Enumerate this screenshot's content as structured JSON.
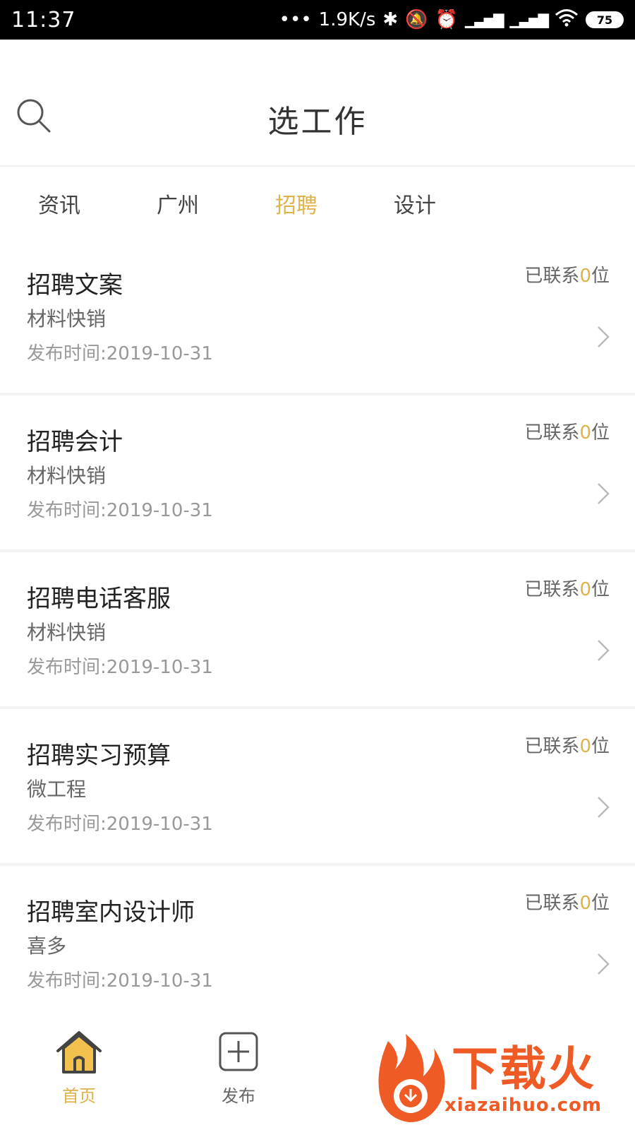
{
  "status_bar": {
    "time": "11:37",
    "net_speed": "1.9K/s",
    "battery": "75",
    "icons": [
      "bluetooth-icon",
      "mute-icon",
      "alarm-icon",
      "hd-signal-icon",
      "signal-icon",
      "wifi-icon",
      "battery-icon"
    ]
  },
  "header": {
    "title": "选工作",
    "search_icon": "search-icon"
  },
  "tabs": [
    {
      "label": "资讯",
      "active": false
    },
    {
      "label": "广州",
      "active": false
    },
    {
      "label": "招聘",
      "active": true
    },
    {
      "label": "设计",
      "active": false
    }
  ],
  "jobs": [
    {
      "title": "招聘文案",
      "company": "材料快销",
      "date": "发布时间:2019-10-31",
      "contact_prefix": "已联系",
      "contact_count": "0",
      "contact_suffix": "位"
    },
    {
      "title": "招聘会计",
      "company": "材料快销",
      "date": "发布时间:2019-10-31",
      "contact_prefix": "已联系",
      "contact_count": "0",
      "contact_suffix": "位"
    },
    {
      "title": "招聘电话客服",
      "company": "材料快销",
      "date": "发布时间:2019-10-31",
      "contact_prefix": "已联系",
      "contact_count": "0",
      "contact_suffix": "位"
    },
    {
      "title": "招聘实习预算",
      "company": "微工程",
      "date": "发布时间:2019-10-31",
      "contact_prefix": "已联系",
      "contact_count": "0",
      "contact_suffix": "位"
    },
    {
      "title": "招聘室内设计师",
      "company": "喜多",
      "date": "发布时间:2019-10-31",
      "contact_prefix": "已联系",
      "contact_count": "0",
      "contact_suffix": "位"
    }
  ],
  "bottom_nav": [
    {
      "label": "首页",
      "icon": "home-icon",
      "active": true
    },
    {
      "label": "发布",
      "icon": "add-icon",
      "active": false
    }
  ],
  "watermark": {
    "text": "下载火",
    "sub": "xiazaihuo.com"
  },
  "colors": {
    "accent": "#e0b34a",
    "watermark": "#f05a24"
  }
}
